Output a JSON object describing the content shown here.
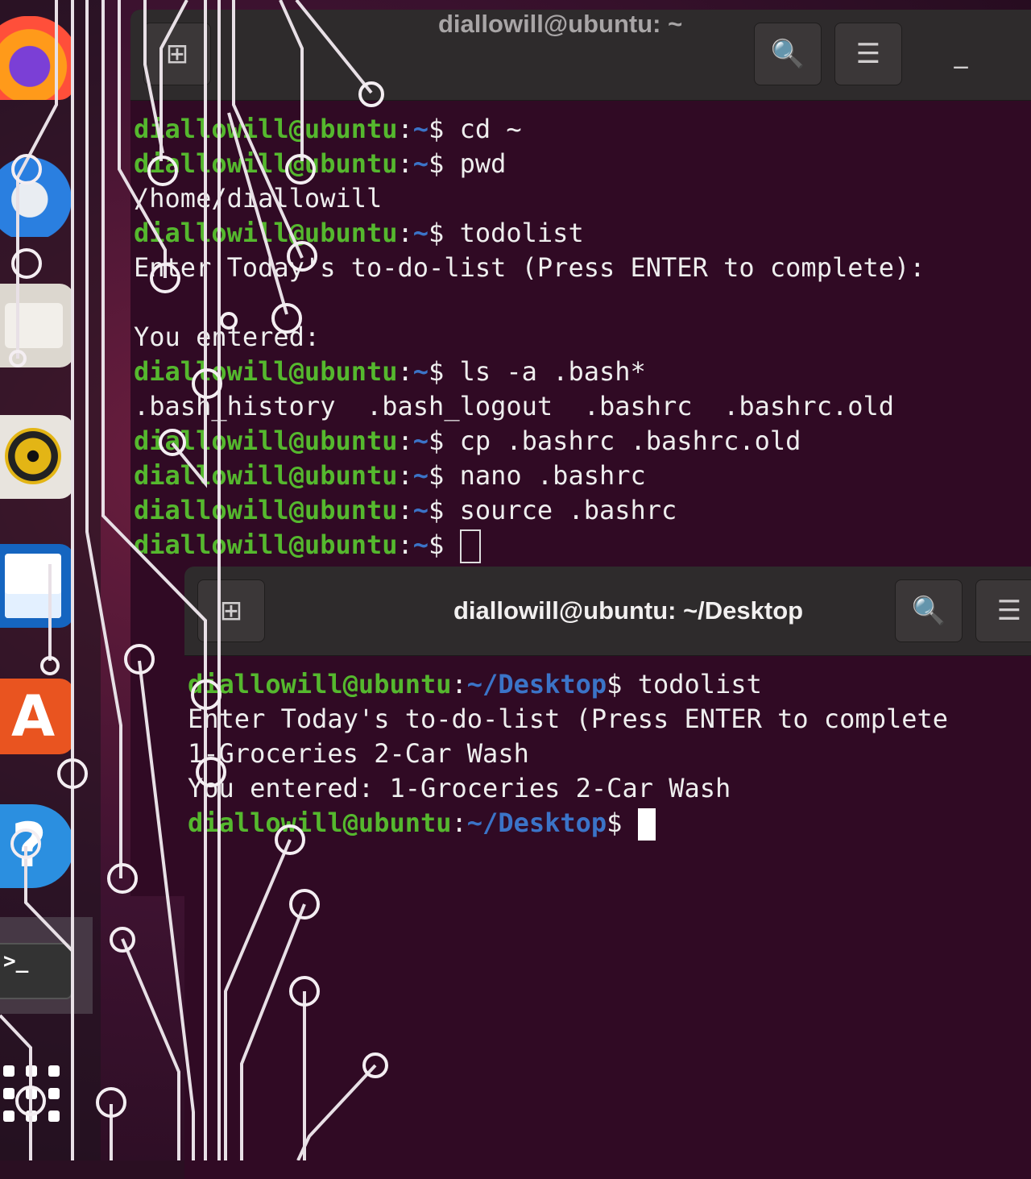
{
  "dock": {
    "items": [
      {
        "name": "firefox-icon",
        "label": "Firefox"
      },
      {
        "name": "thunderbird-icon",
        "label": "Thunderbird"
      },
      {
        "name": "files-icon",
        "label": "Files"
      },
      {
        "name": "rhythmbox-icon",
        "label": "Rhythmbox"
      },
      {
        "name": "libreoffice-writer-icon",
        "label": "LibreOffice Writer"
      },
      {
        "name": "ubuntu-software-icon",
        "label": "Ubuntu Software"
      },
      {
        "name": "help-icon",
        "label": "Help"
      },
      {
        "name": "terminal-icon",
        "label": "Terminal"
      },
      {
        "name": "show-applications-icon",
        "label": "Show Applications"
      }
    ],
    "terminal_prompt_glyph": ">_"
  },
  "window1": {
    "title": "diallowill@ubuntu: ~",
    "lines": [
      {
        "user": "diallowill@ubuntu",
        "path": "~",
        "cmd": "cd ~"
      },
      {
        "user": "diallowill@ubuntu",
        "path": "~",
        "cmd": "pwd"
      },
      {
        "text": "/home/diallowill"
      },
      {
        "user": "diallowill@ubuntu",
        "path": "~",
        "cmd": "todolist"
      },
      {
        "text": "Enter Today's to-do-list (Press ENTER to complete):"
      },
      {
        "text": ""
      },
      {
        "text": "You entered:"
      },
      {
        "user": "diallowill@ubuntu",
        "path": "~",
        "cmd": "ls -a .bash*"
      },
      {
        "text": ".bash_history  .bash_logout  .bashrc  .bashrc.old"
      },
      {
        "user": "diallowill@ubuntu",
        "path": "~",
        "cmd": "cp .bashrc .bashrc.old"
      },
      {
        "user": "diallowill@ubuntu",
        "path": "~",
        "cmd": "nano .bashrc"
      },
      {
        "user": "diallowill@ubuntu",
        "path": "~",
        "cmd": "source .bashrc"
      },
      {
        "user": "diallowill@ubuntu",
        "path": "~",
        "cmd": ""
      }
    ]
  },
  "window2": {
    "title": "diallowill@ubuntu: ~/Desktop",
    "lines": [
      {
        "user": "diallowill@ubuntu",
        "path": "~/Desktop",
        "cmd": "todolist"
      },
      {
        "text": "Enter Today's to-do-list (Press ENTER to complete"
      },
      {
        "text": "1-Groceries 2-Car Wash"
      },
      {
        "text": "You entered: 1-Groceries 2-Car Wash"
      },
      {
        "user": "diallowill@ubuntu",
        "path": "~/Desktop",
        "cmd": ""
      }
    ]
  },
  "glyphs": {
    "new_tab": "⊞",
    "search": "🔍",
    "menu": "☰",
    "minimize": "_"
  },
  "colors": {
    "terminal_bg": "#300a24",
    "prompt_user": "#55b82e",
    "prompt_path": "#3b74c8",
    "titlebar": "#2e2b2c"
  }
}
